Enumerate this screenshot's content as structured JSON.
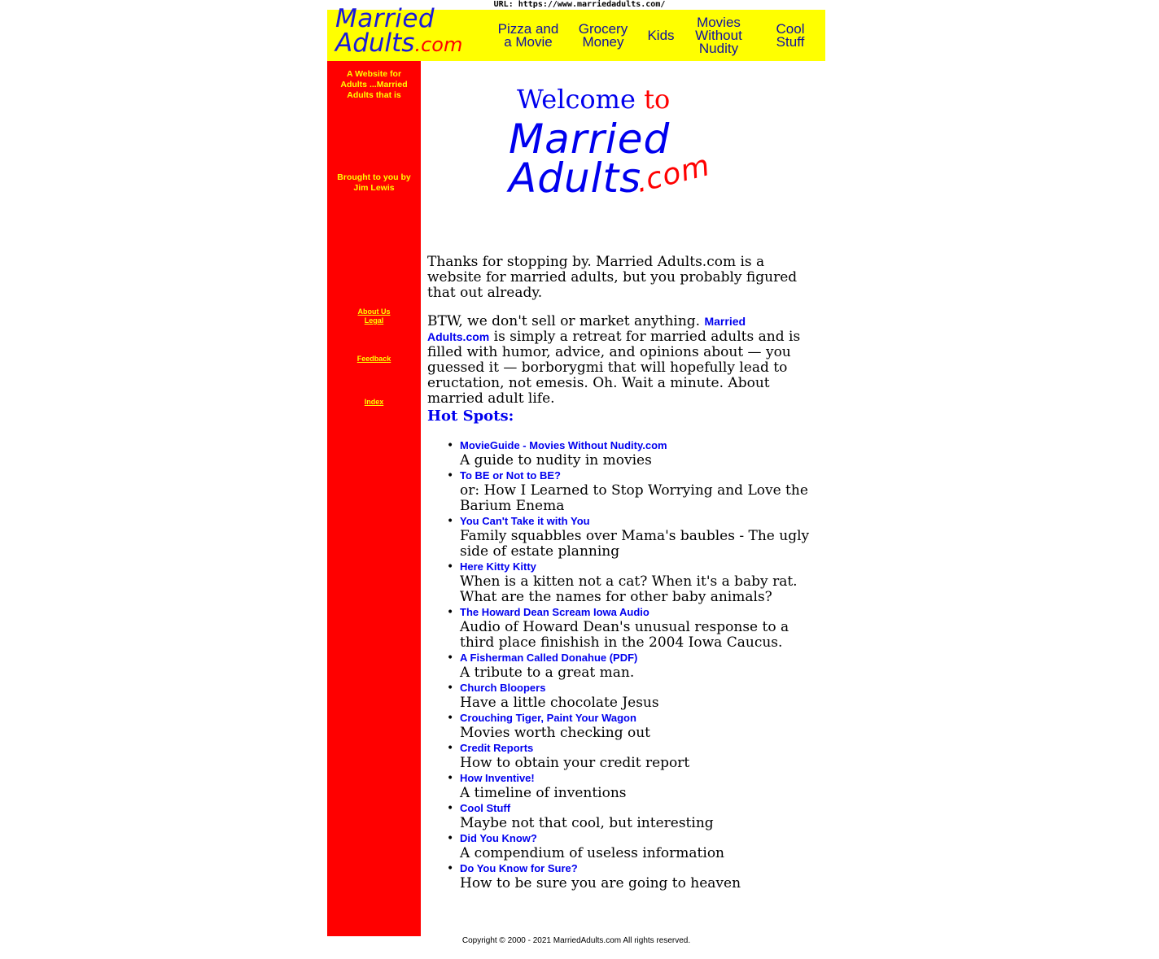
{
  "url_bar": "URL: https://www.marriedadults.com/",
  "header": {
    "logo_line1": "Married",
    "logo_line2": "Adults",
    "logo_dot": ".com",
    "nav": [
      {
        "line1": "Pizza and",
        "line2": "a Movie"
      },
      {
        "line1": "Grocery",
        "line2": "Money"
      },
      {
        "line1": "Kids",
        "line2": ""
      },
      {
        "line1": "Movies",
        "line2": "Without",
        "line3": "Nudity"
      },
      {
        "line1": "Cool",
        "line2": "Stuff"
      }
    ]
  },
  "sidebar": {
    "tagline": "A Website for Adults ...Married Adults that is",
    "brought_by": "Brought to you by Jim Lewis",
    "about": "About Us",
    "legal": "Legal",
    "feedback": "Feedback",
    "index": "Index"
  },
  "main": {
    "welcome": "Welcome",
    "welcome_to": "to",
    "logo_line1": "Married",
    "logo_line2": "Adults",
    "logo_dot": ".com",
    "para1": "Thanks for stopping by. Married Adults.com is a website for married adults, but you probably figured that out already.",
    "para2_start": "BTW, we don't sell or market anything. ",
    "para2_link": "Married Adults.com",
    "para2_end": " is simply a retreat for married adults and is filled with humor, advice, and opinions about — you guessed it — borborygmi that will hopefully lead to eructation, not emesis. Oh. Wait a minute. About married adult life.",
    "hot_spots": "Hot Spots:",
    "items": [
      {
        "title": "MovieGuide - Movies Without Nudity.com",
        "desc": "A guide to nudity in movies"
      },
      {
        "title": "To BE or Not to BE?",
        "desc": "or: How I Learned to Stop Worrying and Love the Barium Enema"
      },
      {
        "title": "You Can't Take it with You",
        "desc": "Family squabbles over Mama's baubles - The ugly side of estate planning"
      },
      {
        "title": "Here Kitty Kitty",
        "desc": "When is a kitten not a cat? When it's a baby rat. What are the names for other baby animals?"
      },
      {
        "title": "The Howard Dean Scream Iowa Audio",
        "desc": "Audio of Howard Dean's unusual response to a third place finishish in the 2004 Iowa Caucus."
      },
      {
        "title": "A Fisherman Called Donahue (PDF)",
        "desc": "A tribute to a great man."
      },
      {
        "title": "Church Bloopers",
        "desc": "Have a little chocolate Jesus"
      },
      {
        "title": "Crouching Tiger, Paint Your Wagon",
        "desc": "Movies worth checking out"
      },
      {
        "title": "Credit Reports",
        "desc": "How to obtain your credit report"
      },
      {
        "title": "How Inventive!",
        "desc": "A timeline of inventions"
      },
      {
        "title": "Cool Stuff",
        "desc": "Maybe not that cool, but interesting"
      },
      {
        "title": "Did You Know?",
        "desc": "A compendium of useless information"
      },
      {
        "title": "Do You Know for Sure?",
        "desc": "How to be sure you are going to heaven"
      }
    ]
  },
  "footer": {
    "copyright": "Copyright © 2000 - 2021 MarriedAdults.com All rights reserved."
  },
  "colors": {
    "header_bg": "#ffff00",
    "sidebar_bg": "#ff0000",
    "link": "#0000ee",
    "accent_red": "#ff0000"
  }
}
